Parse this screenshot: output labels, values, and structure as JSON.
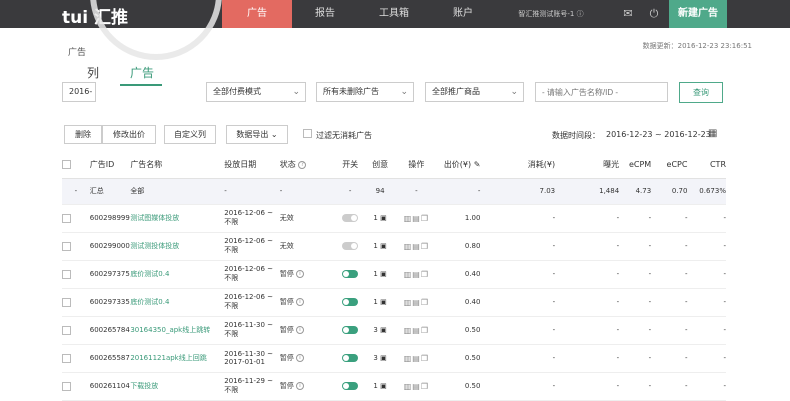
{
  "brand": {
    "logo": "tui 汇推"
  },
  "nav": [
    {
      "label": "广告",
      "active": true
    },
    {
      "label": "报告",
      "active": false
    },
    {
      "label": "工具箱",
      "active": false
    },
    {
      "label": "账户",
      "active": false
    }
  ],
  "account": {
    "name": "智汇推测试账号-1",
    "info_icon": "info-icon"
  },
  "top_icons": [
    "mail-icon",
    "power-icon"
  ],
  "new_ad_label": "新建广告",
  "updated_text": "数据更新：2016-12-23 23:16:51",
  "breadcrumb": "广告",
  "tabs": [
    {
      "label": "列",
      "active": false
    },
    {
      "label": "广告",
      "active": true
    }
  ],
  "filters": {
    "date": "2016-",
    "billing": "全部付费模式",
    "status": "所有未删除广告",
    "product": "全部推广商品",
    "search_placeholder": "- 请输入广告名称/ID -",
    "query_label": "查询"
  },
  "toolbar": {
    "delete": "删除",
    "edit_bid": "修改出价",
    "custom_cols": "自定义列",
    "export": "数据导出",
    "filter_label": "过滤无消耗广告",
    "date_label": "数据时间段：",
    "date_range": "2016-12-23 ~ 2016-12-23"
  },
  "columns": [
    "广告ID",
    "广告名称",
    "投放日期",
    "状态",
    "开关",
    "创意",
    "操作",
    "出价(¥)",
    "消耗(¥)",
    "曝光",
    "eCPM",
    "eCPC",
    "CTR"
  ],
  "summary": {
    "c0": "-",
    "id": "汇总",
    "name": "全部",
    "date": "-",
    "status": "-",
    "switch": "-",
    "creative": "94",
    "ops": "-",
    "bid": "-",
    "cost": "7.03",
    "imp": "1,484",
    "ecpm": "4.73",
    "ecpc": "0.70",
    "ctr": "0.673%"
  },
  "rows": [
    {
      "id": "600298999",
      "name": "测试图媒体投放",
      "date": "2016-12-06 ~ 不限",
      "status": "无效",
      "switch": "off",
      "creative": "1",
      "bid": "1.00",
      "cost": "-",
      "imp": "-",
      "ecpm": "-",
      "ecpc": "-",
      "ctr": "-"
    },
    {
      "id": "600299000",
      "name": "测试测投体投放",
      "date": "2016-12-06 ~ 不限",
      "status": "无效",
      "switch": "off",
      "creative": "1",
      "bid": "0.80",
      "cost": "-",
      "imp": "-",
      "ecpm": "-",
      "ecpc": "-",
      "ctr": "-"
    },
    {
      "id": "600297375",
      "name": "底价测试0.4",
      "date": "2016-12-06 ~ 不限",
      "status": "暂停",
      "switch": "on",
      "creative": "1",
      "bid": "0.40",
      "cost": "-",
      "imp": "-",
      "ecpm": "-",
      "ecpc": "-",
      "ctr": "-"
    },
    {
      "id": "600297335",
      "name": "底价测试0.4",
      "date": "2016-12-06 ~ 不限",
      "status": "暂停",
      "switch": "on",
      "creative": "1",
      "bid": "0.40",
      "cost": "-",
      "imp": "-",
      "ecpm": "-",
      "ecpc": "-",
      "ctr": "-"
    },
    {
      "id": "600265784",
      "name": "30164350_apk线上跳转",
      "date": "2016-11-30 ~ 不限",
      "status": "暂停",
      "switch": "on",
      "creative": "3",
      "bid": "0.50",
      "cost": "-",
      "imp": "-",
      "ecpm": "-",
      "ecpc": "-",
      "ctr": "-"
    },
    {
      "id": "600265587",
      "name": "20161121apk线上回跳",
      "date": "2016-11-30 ~ 2017-01-01",
      "status": "暂停",
      "switch": "on",
      "creative": "3",
      "bid": "0.50",
      "cost": "-",
      "imp": "-",
      "ecpm": "-",
      "ecpc": "-",
      "ctr": "-"
    },
    {
      "id": "600261104",
      "name": "下载投放",
      "date": "2016-11-29 ~ 不限",
      "status": "暂停",
      "switch": "on",
      "creative": "1",
      "bid": "0.50",
      "cost": "-",
      "imp": "-",
      "ecpm": "-",
      "ecpc": "-",
      "ctr": "-"
    }
  ]
}
